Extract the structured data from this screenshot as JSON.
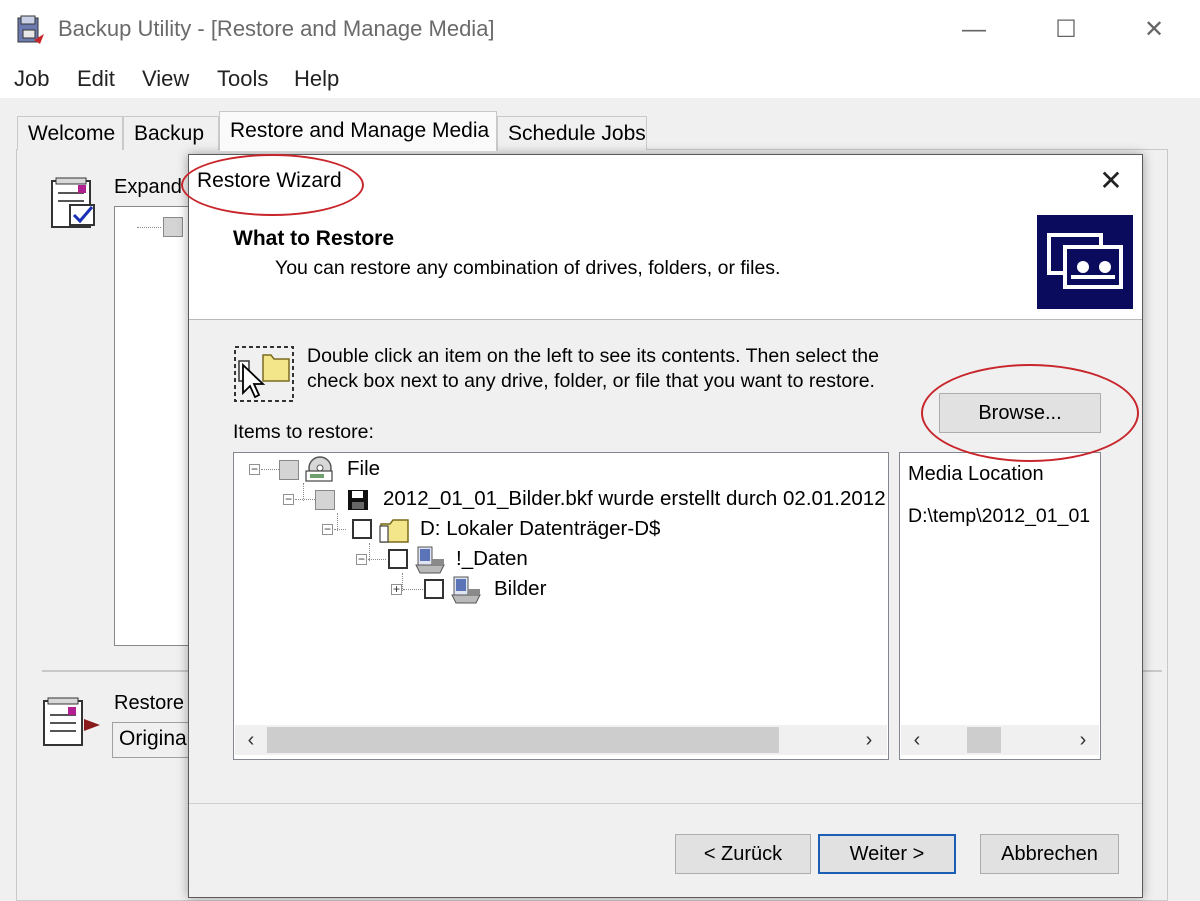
{
  "window": {
    "title": "Backup Utility - [Restore and Manage Media]",
    "minimize_glyph": "—",
    "maximize_glyph": "☐",
    "close_glyph": "✕"
  },
  "menu": [
    "Job",
    "Edit",
    "View",
    "Tools",
    "Help"
  ],
  "tabs": [
    "Welcome",
    "Backup",
    "Restore and Manage Media",
    "Schedule Jobs"
  ],
  "active_tab": "Restore and Manage Media",
  "background": {
    "expand_label": "Expand",
    "restore_label": "Restore",
    "restore_select_value": "Original"
  },
  "dialog": {
    "title": "Restore Wizard",
    "close_glyph": "✕",
    "header_title": "What to Restore",
    "header_subtitle": "You can restore any combination of drives, folders, or files.",
    "instruction_line1": "Double click an item on the left to see its contents. Then select the",
    "instruction_line2": "check box next to any drive, folder, or file that you want to restore.",
    "browse_button": "Browse...",
    "items_label": "Items to restore:",
    "tree": [
      {
        "label": "File",
        "expander": "−",
        "checkbox": "indeterminate",
        "icon": "disk-file-icon"
      },
      {
        "label": "2012_01_01_Bilder.bkf wurde erstellt durch 02.01.2012",
        "expander": "−",
        "checkbox": "indeterminate",
        "icon": "floppy-icon"
      },
      {
        "label": "D: Lokaler Datenträger-D$",
        "expander": "−",
        "checkbox": "unchecked",
        "icon": "drive-folder-icon"
      },
      {
        "label": "!_Daten",
        "expander": "−",
        "checkbox": "unchecked",
        "icon": "network-folder-icon"
      },
      {
        "label": "Bilder",
        "expander": "+",
        "checkbox": "unchecked",
        "icon": "network-folder-icon"
      }
    ],
    "media_header": "Media Location",
    "media_value": "D:\\temp\\2012_01_01",
    "back_button": "< Zurück",
    "next_button": "Weiter >",
    "cancel_button": "Abbrechen",
    "annotation_color": "#c8262b"
  }
}
